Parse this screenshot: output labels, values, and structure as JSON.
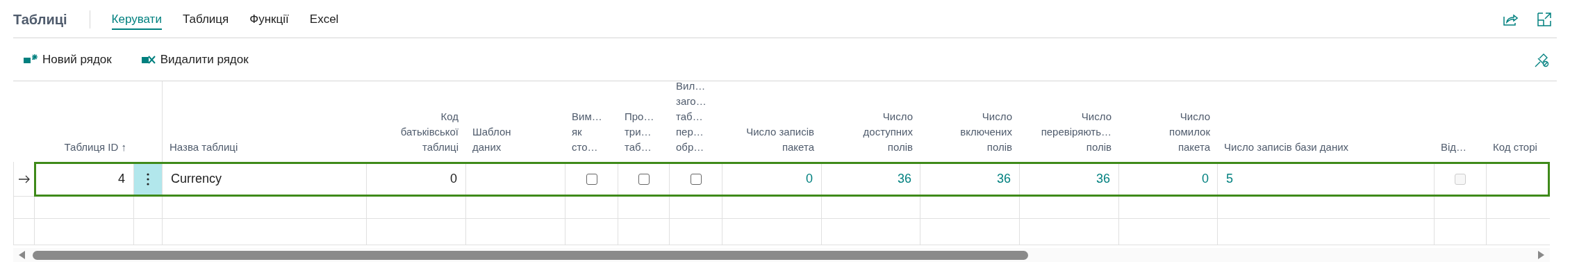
{
  "page": {
    "title": "Таблиці"
  },
  "tabs": [
    {
      "label": "Керувати",
      "selected": true
    },
    {
      "label": "Таблиця",
      "selected": false
    },
    {
      "label": "Функції",
      "selected": false
    },
    {
      "label": "Excel",
      "selected": false
    }
  ],
  "actions": [
    {
      "label": "Новий рядок",
      "kind": "new"
    },
    {
      "label": "Видалити рядок",
      "kind": "delete"
    }
  ],
  "table": {
    "columns": [
      {
        "lines": [
          "Таблиця ID ↑"
        ],
        "kind": "number"
      },
      {
        "kind": "menu"
      },
      {
        "lines": [
          "Назва таблиці"
        ],
        "kind": "text"
      },
      {
        "lines": [
          "Код",
          "батьківської",
          "таблиці"
        ],
        "kind": "number"
      },
      {
        "lines": [
          "Шаблон",
          "даних"
        ],
        "kind": "text"
      },
      {
        "lines": [
          "Вим…",
          "як",
          "сто…"
        ],
        "kind": "check"
      },
      {
        "lines": [
          "Про…",
          "три…",
          "таб…"
        ],
        "kind": "check"
      },
      {
        "lines": [
          "Вил…",
          "заго…",
          "таб…",
          "пер…",
          "обр…"
        ],
        "kind": "check"
      },
      {
        "lines": [
          "Число записів",
          "пакета"
        ],
        "kind": "number"
      },
      {
        "lines": [
          "Число",
          "доступних",
          "полів"
        ],
        "kind": "number"
      },
      {
        "lines": [
          "Число",
          "включених",
          "полів"
        ],
        "kind": "number"
      },
      {
        "lines": [
          "Число",
          "перевіряють…",
          "полів"
        ],
        "kind": "number"
      },
      {
        "lines": [
          "Число",
          "помилок",
          "пакета"
        ],
        "kind": "number"
      },
      {
        "lines": [
          "Число записів бази даних"
        ],
        "kind": "text"
      },
      {
        "lines": [
          "Від…"
        ],
        "kind": "check"
      },
      {
        "lines": [
          "Код сторі"
        ],
        "kind": "text"
      }
    ],
    "rows": [
      {
        "selected": true,
        "current": true,
        "cells": [
          {
            "kind": "text",
            "text": "4"
          },
          {
            "kind": "menu"
          },
          {
            "kind": "text",
            "text": "Currency"
          },
          {
            "kind": "text",
            "text": "0"
          },
          {
            "kind": "empty"
          },
          {
            "kind": "check",
            "checked": false,
            "disabled": false
          },
          {
            "kind": "check",
            "checked": false,
            "disabled": false
          },
          {
            "kind": "check",
            "checked": false,
            "disabled": false
          },
          {
            "kind": "link",
            "text": "0"
          },
          {
            "kind": "link",
            "text": "36"
          },
          {
            "kind": "link",
            "text": "36"
          },
          {
            "kind": "link",
            "text": "36"
          },
          {
            "kind": "link",
            "text": "0"
          },
          {
            "kind": "link",
            "text": "5"
          },
          {
            "kind": "check",
            "checked": false,
            "disabled": true
          },
          {
            "kind": "empty"
          }
        ]
      }
    ]
  }
}
